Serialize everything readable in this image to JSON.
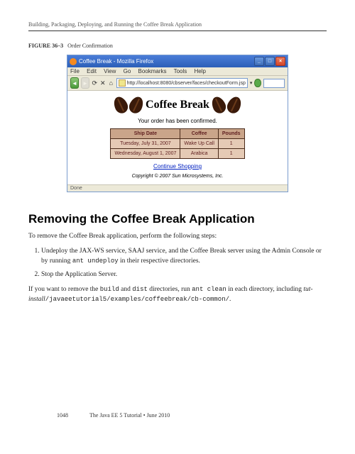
{
  "header": "Building, Packaging, Deploying, and Running the Coffee Break Application",
  "figure": {
    "num": "FIGURE 36–3",
    "caption": "Order Confirmation"
  },
  "browser": {
    "title": "Coffee Break - Mozilla Firefox",
    "menus": [
      "File",
      "Edit",
      "View",
      "Go",
      "Bookmarks",
      "Tools",
      "Help"
    ],
    "url": "http://localhost:8080/cbserver/faces/checkoutForm.jsp",
    "logo_text": "Coffee Break",
    "confirm": "Your order has been confirmed.",
    "table": {
      "headers": [
        "Ship Date",
        "Coffee",
        "Pounds"
      ],
      "rows": [
        [
          "Tuesday, July 31, 2007",
          "Wake Up Call",
          "1"
        ],
        [
          "Wednesday, August 1, 2007",
          "Arabica",
          "1"
        ]
      ]
    },
    "continue": "Continue Shopping",
    "copyright": "Copyright © 2007 Sun Microsystems, Inc.",
    "status": "Done"
  },
  "section": {
    "heading": "Removing the Coffee Break Application",
    "intro": "To remove the Coffee Break application, perform the following steps:",
    "steps": [
      {
        "pre": "Undeploy the JAX-WS service, SAAJ service, and the Coffee Break server using the Admin Console or by running ",
        "code": "ant undeploy",
        "post": " in their respective directories."
      },
      {
        "pre": "Stop the Application Server.",
        "code": "",
        "post": ""
      }
    ],
    "after_p1": "If you want to remove the ",
    "after_c1": "build",
    "after_p2": " and ",
    "after_c2": "dist",
    "after_p3": " directories, run ",
    "after_c3": "ant clean",
    "after_p4": " in each directory, including ",
    "after_path": "tut-install",
    "after_c4": "/javaeetutorial5/examples/coffeebreak/cb-common/",
    "after_p5": "."
  },
  "footer": {
    "page": "1048",
    "text": "The Java EE 5 Tutorial  •  June 2010"
  }
}
